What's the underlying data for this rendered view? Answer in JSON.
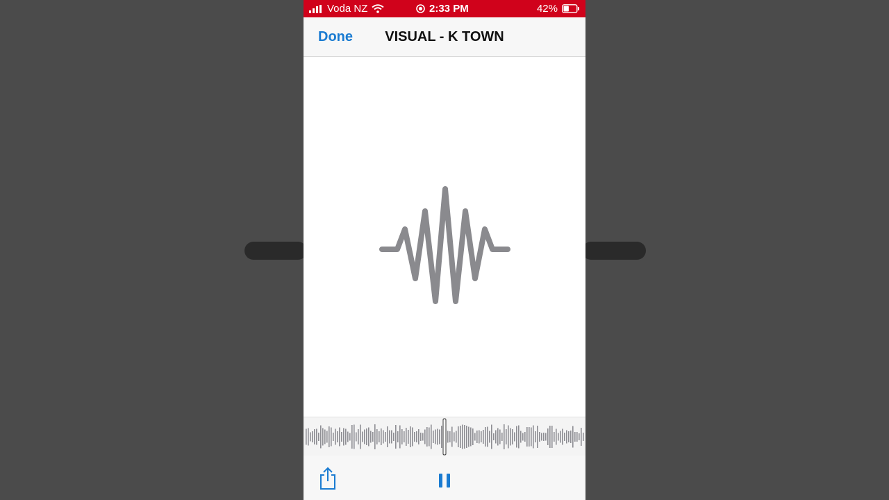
{
  "status_bar": {
    "carrier": "Voda NZ",
    "time": "2:33 PM",
    "battery": "42%",
    "battery_level": 0.42,
    "icons": [
      "signal-icon",
      "wifi-icon",
      "recording-icon",
      "battery-icon"
    ]
  },
  "nav": {
    "done_label": "Done",
    "title": "VISUAL - K TOWN"
  },
  "content": {
    "placeholder_icon": "waveform-icon"
  },
  "toolbar": {
    "share_icon": "share-icon",
    "pause_icon": "pause-icon"
  },
  "colors": {
    "status_bar": "#d0021b",
    "accent": "#1a7bd1",
    "waveform": "#8a8a8e",
    "background": "#4b4b4b"
  }
}
